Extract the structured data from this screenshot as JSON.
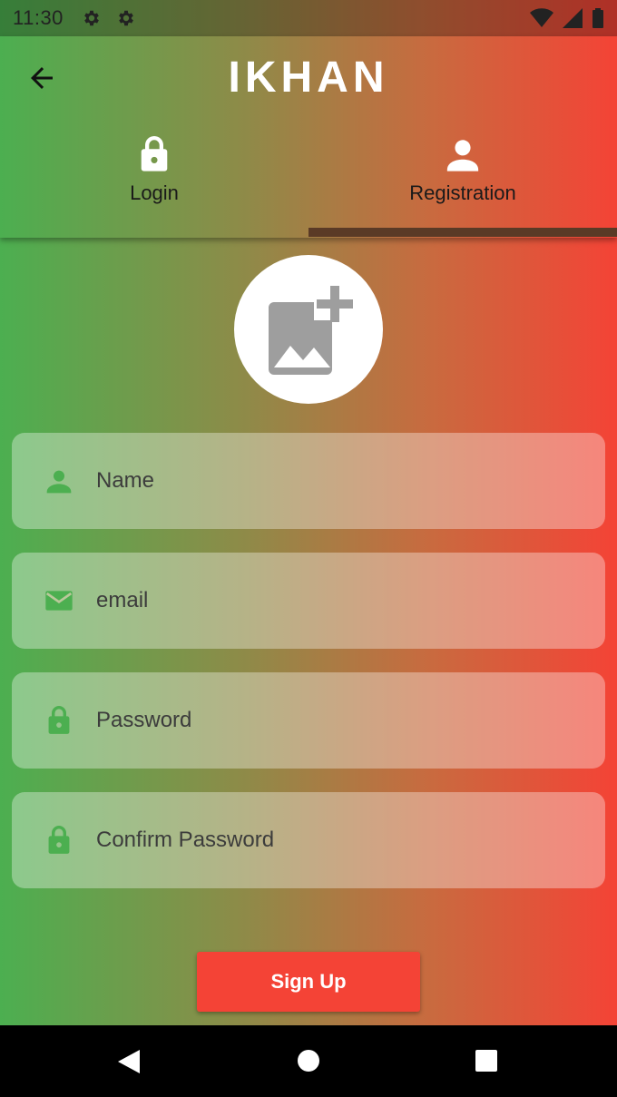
{
  "status_bar": {
    "time": "11:30"
  },
  "app_bar": {
    "title": "IKHAN"
  },
  "tabs": [
    {
      "label": "Login",
      "icon": "lock-icon",
      "selected": false
    },
    {
      "label": "Registration",
      "icon": "person-icon",
      "selected": true
    }
  ],
  "avatar": {
    "icon": "add-photo-icon"
  },
  "form": {
    "name_placeholder": "Name",
    "email_placeholder": "email",
    "password_placeholder": "Password",
    "confirm_password_placeholder": "Confirm Password"
  },
  "signup_button": {
    "label": "Sign Up"
  },
  "colors": {
    "gradient_start": "#4caf50",
    "gradient_end": "#f44336",
    "button": "#f44336",
    "field_icon": "#4caf50"
  }
}
